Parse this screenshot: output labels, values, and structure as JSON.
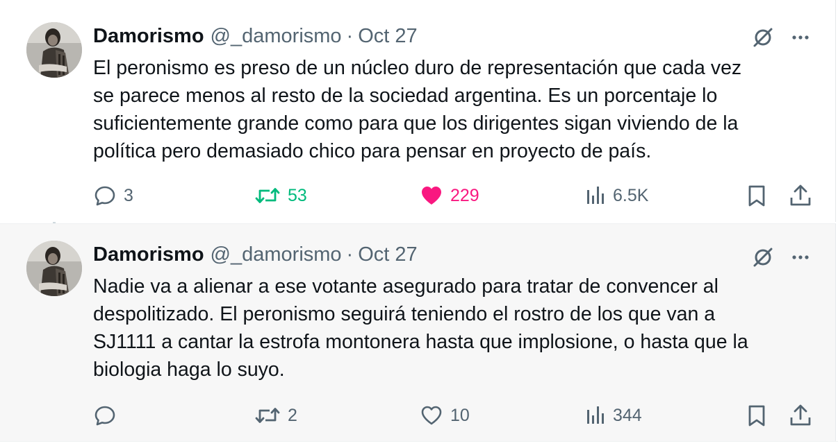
{
  "tweets": [
    {
      "author": {
        "name": "Damorismo",
        "handle": "@_damorismo",
        "avatar_icon": "profile-photo"
      },
      "separator": "·",
      "date": "Oct 27",
      "text": "El peronismo es preso de un núcleo duro de representación que cada vez\nse parece menos al resto de la sociedad argentina. Es un porcentaje lo\nsuficientemente grande como para que los dirigentes sigan viviendo de la\npolítica pero demasiado chico para pensar en proyecto de país.",
      "actions": {
        "replies": "3",
        "retweets": "53",
        "likes": "229",
        "views": "6.5K"
      },
      "state": {
        "retweeted": true,
        "liked": true
      }
    },
    {
      "author": {
        "name": "Damorismo",
        "handle": "@_damorismo",
        "avatar_icon": "profile-photo"
      },
      "separator": "·",
      "date": "Oct 27",
      "text": "Nadie va a alienar a ese votante asegurado para tratar de convencer al\ndespolitizado. El peronismo seguirá teniendo el rostro de los que van a\nSJ1111 a cantar la estrofa montonera hasta que implosione, o hasta que la\nbiologia haga lo suyo.",
      "actions": {
        "replies": "",
        "retweets": "2",
        "likes": "10",
        "views": "344"
      },
      "state": {
        "retweeted": false,
        "liked": false
      }
    }
  ],
  "colors": {
    "text": "#0f1419",
    "muted": "#536471",
    "retweet_active": "#00ba7c",
    "like_active": "#f91880",
    "thread_line": "#cfd9de"
  },
  "icons": [
    "grok-icon",
    "more-icon",
    "reply-icon",
    "retweet-icon",
    "like-icon",
    "views-icon",
    "bookmark-icon",
    "share-icon"
  ]
}
